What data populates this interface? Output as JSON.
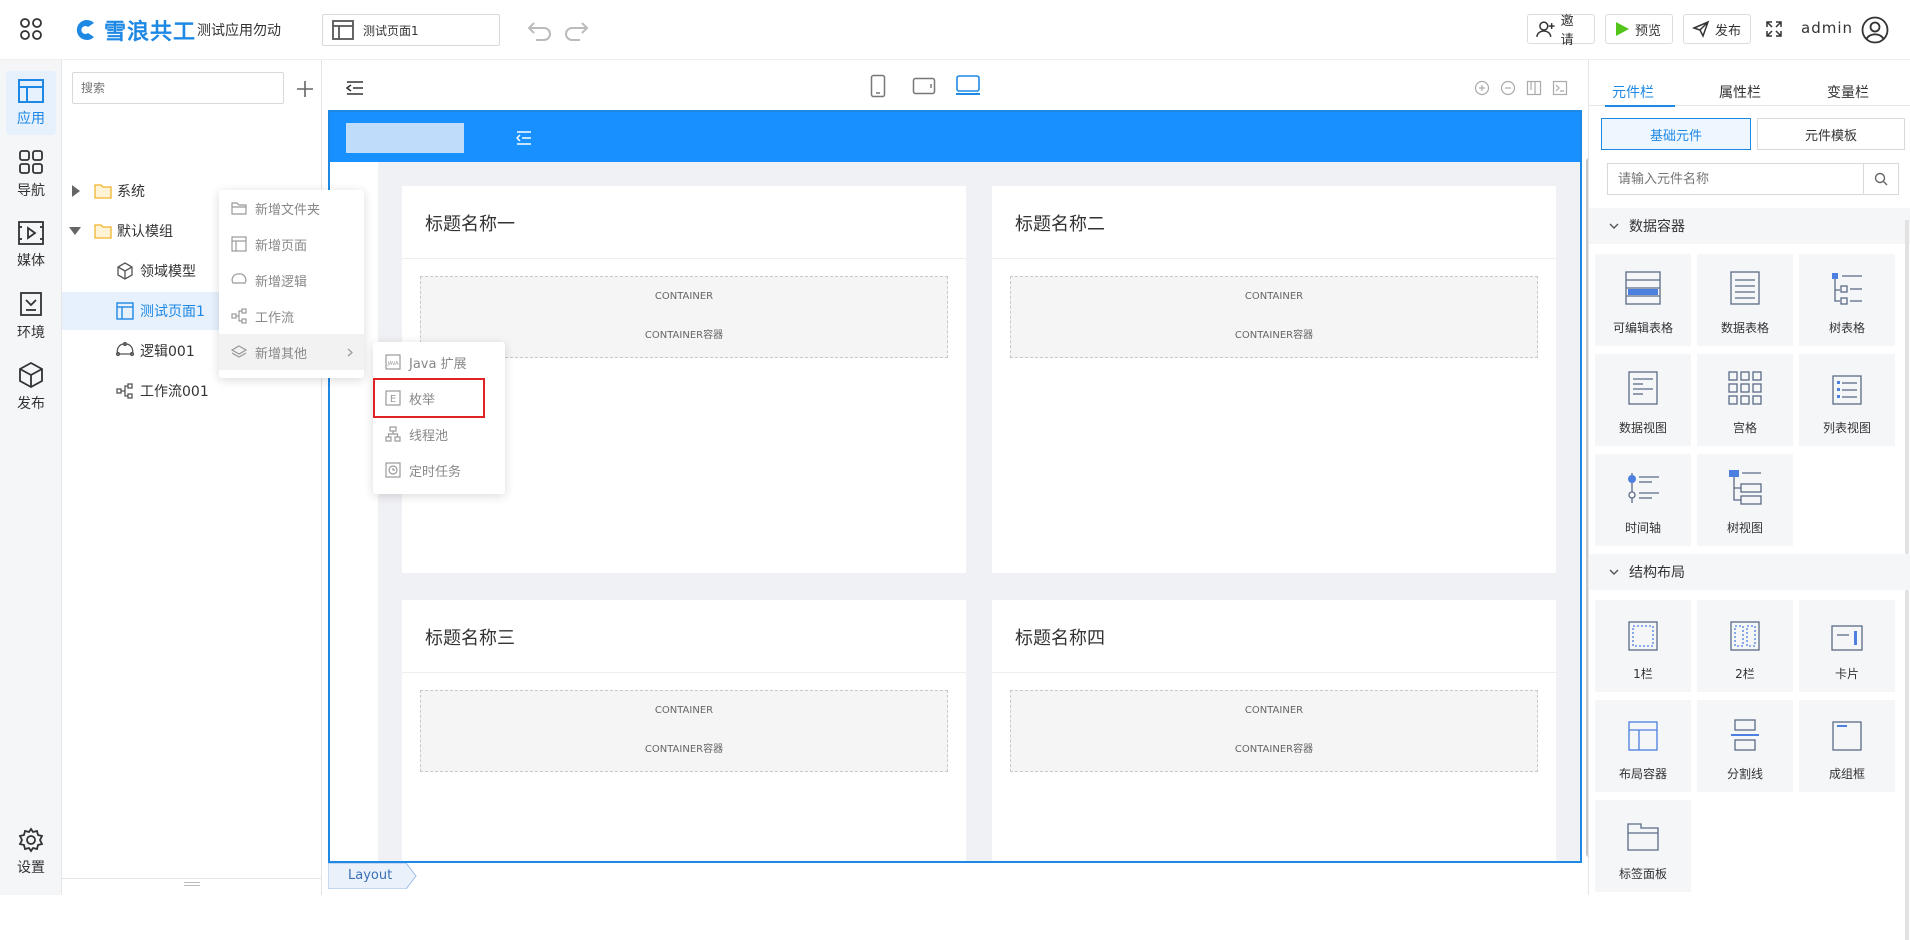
{
  "header": {
    "brand": "雪浪共工",
    "app_name": "测试应用勿动",
    "current_page": "测试页面1",
    "invite": "邀请",
    "preview": "预览",
    "publish": "发布",
    "user": "admin"
  },
  "rail": {
    "items": [
      {
        "label": "应用",
        "icon": "app-icon",
        "active": true
      },
      {
        "label": "导航",
        "icon": "grid-icon"
      },
      {
        "label": "媒体",
        "icon": "media-icon"
      },
      {
        "label": "环境",
        "icon": "env-icon"
      },
      {
        "label": "发布",
        "icon": "cube-icon"
      }
    ],
    "settings": "设置"
  },
  "tree": {
    "search_placeholder": "搜索",
    "nodes": [
      {
        "label": "系统",
        "type": "folder"
      },
      {
        "label": "默认模组",
        "type": "folder"
      },
      {
        "label": "领域模型",
        "type": "model"
      },
      {
        "label": "测试页面1",
        "type": "page"
      },
      {
        "label": "逻辑001",
        "type": "logic"
      },
      {
        "label": "工作流001",
        "type": "workflow"
      }
    ]
  },
  "context_menu": {
    "items": [
      "新增文件夹",
      "新增页面",
      "新增逻辑",
      "工作流",
      "新增其他"
    ],
    "submenu": [
      "Java 扩展",
      "枚举",
      "线程池",
      "定时任务"
    ]
  },
  "canvas": {
    "cards": [
      {
        "title": "标题名称一",
        "container": "CONTAINER",
        "container_sub": "CONTAINER容器"
      },
      {
        "title": "标题名称二",
        "container": "CONTAINER",
        "container_sub": "CONTAINER容器"
      },
      {
        "title": "标题名称三",
        "container": "CONTAINER",
        "container_sub": "CONTAINER容器"
      },
      {
        "title": "标题名称四",
        "container": "CONTAINER",
        "container_sub": "CONTAINER容器"
      }
    ],
    "breadcrumb": "Layout",
    "accent_color": "#1e88e5"
  },
  "right_panel": {
    "tabs": [
      "元件栏",
      "属性栏",
      "变量栏"
    ],
    "subtabs": [
      "基础元件",
      "元件模板"
    ],
    "search_placeholder": "请输入元件名称",
    "sections": [
      {
        "title": "数据容器",
        "items": [
          "可编辑表格",
          "数据表格",
          "树表格",
          "数据视图",
          "宫格",
          "列表视图",
          "时间轴",
          "树视图"
        ]
      },
      {
        "title": "结构布局",
        "items": [
          "1栏",
          "2栏",
          "卡片",
          "布局容器",
          "分割线",
          "成组框",
          "标签面板"
        ]
      }
    ]
  }
}
